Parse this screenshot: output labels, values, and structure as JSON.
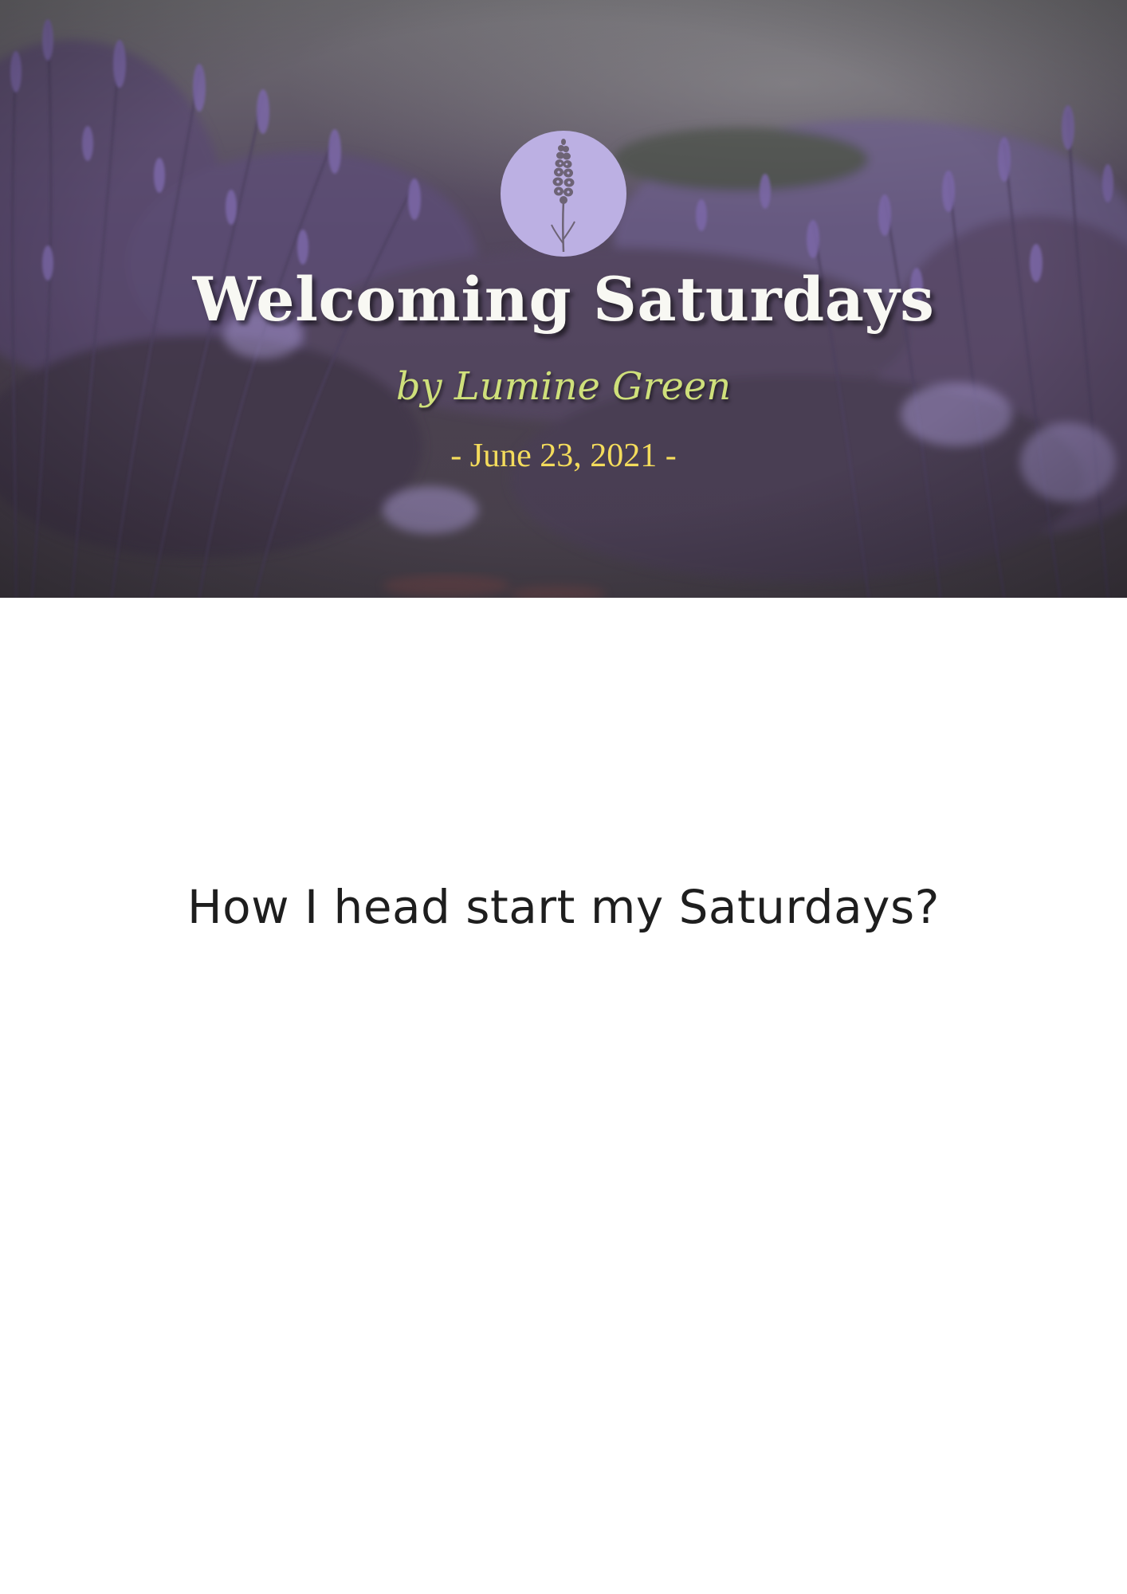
{
  "hero": {
    "title": "Welcoming Saturdays",
    "author": "by Lumine Green",
    "date": "- June 23, 2021 -",
    "logo_icon": "lavender-sprig-icon",
    "colors": {
      "badge": "#bcb0e3",
      "title": "#f8f8f3",
      "author": "#cfe07b",
      "date": "#f4dc5c"
    }
  },
  "main": {
    "question": "How I head start my Saturdays?"
  }
}
